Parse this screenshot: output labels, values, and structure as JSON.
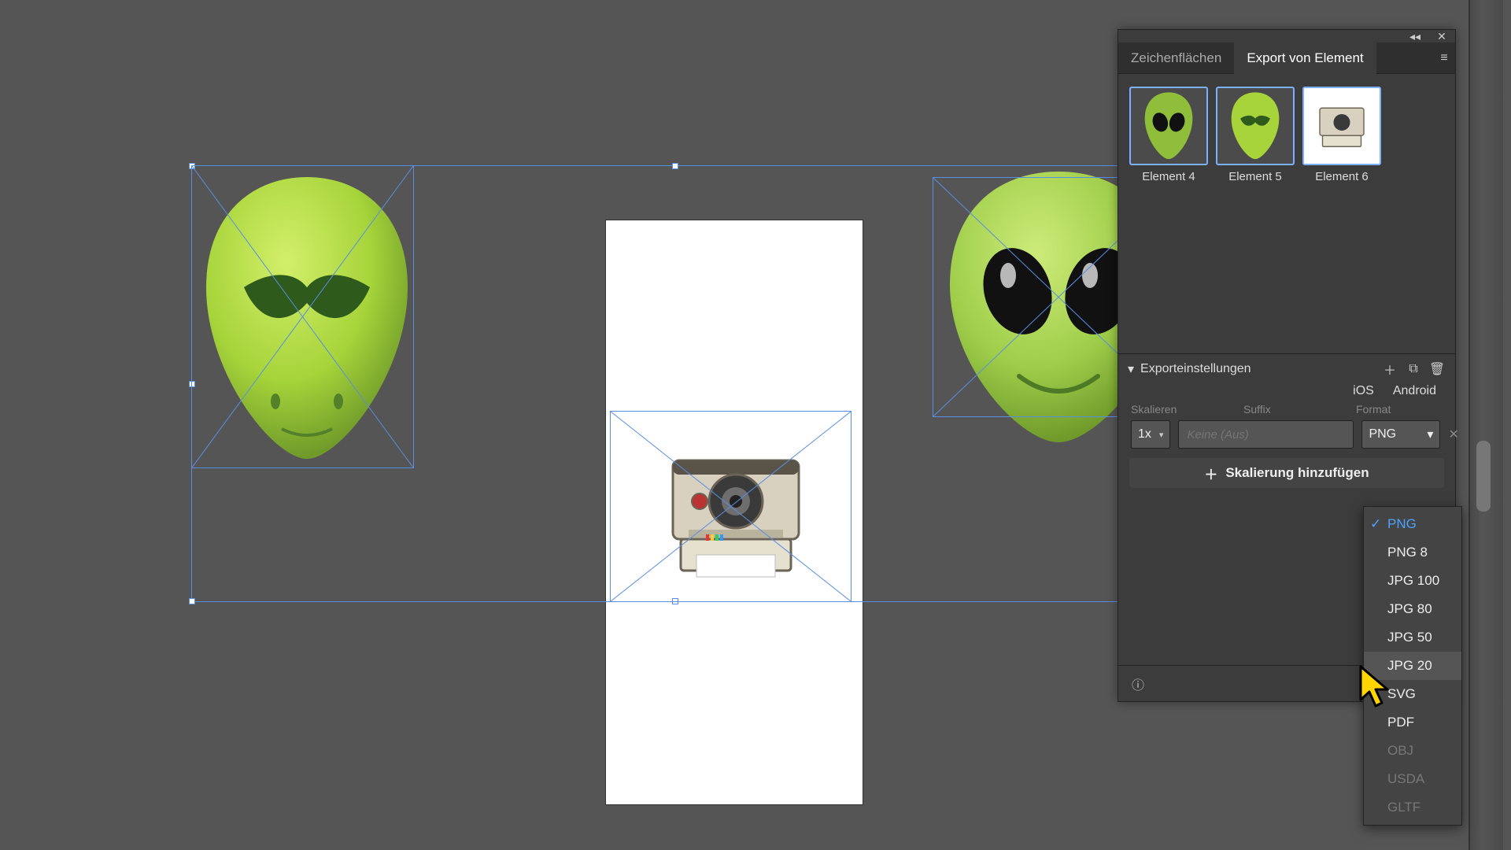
{
  "panel": {
    "tabs": {
      "artboards": "Zeichenflächen",
      "export_element": "Export von Element"
    },
    "thumbs": [
      {
        "label": "Element 4",
        "kind": "alien-angry"
      },
      {
        "label": "Element 5",
        "kind": "alien-side"
      },
      {
        "label": "Element 6",
        "kind": "camera"
      }
    ],
    "section_title": "Exporteinstellungen",
    "platforms": {
      "ios": "iOS",
      "android": "Android"
    },
    "cols": {
      "scale": "Skalieren",
      "suffix": "Suffix",
      "format": "Format"
    },
    "row": {
      "scale": "1x",
      "suffix_placeholder": "Keine (Aus)",
      "format": "PNG"
    },
    "add_scale": "Skalierung hinzufügen"
  },
  "dropdown": {
    "options": [
      {
        "label": "PNG",
        "state": "selected"
      },
      {
        "label": "PNG 8",
        "state": ""
      },
      {
        "label": "JPG 100",
        "state": ""
      },
      {
        "label": "JPG 80",
        "state": ""
      },
      {
        "label": "JPG 50",
        "state": ""
      },
      {
        "label": "JPG 20",
        "state": "hover"
      },
      {
        "label": "SVG",
        "state": ""
      },
      {
        "label": "PDF",
        "state": ""
      },
      {
        "label": "OBJ",
        "state": "disabled"
      },
      {
        "label": "USDA",
        "state": "disabled"
      },
      {
        "label": "GLTF",
        "state": "disabled"
      }
    ]
  },
  "icons": {
    "collapse": "◂◂",
    "close": "✕",
    "menu": "≡",
    "add": "＋",
    "duplicate": "⧉",
    "trash": "🗑",
    "caret_down": "▾",
    "chevron_down": "▾",
    "plus_small": "＋",
    "info": "ⓘ",
    "export": "⍈",
    "row_remove": "✕"
  }
}
